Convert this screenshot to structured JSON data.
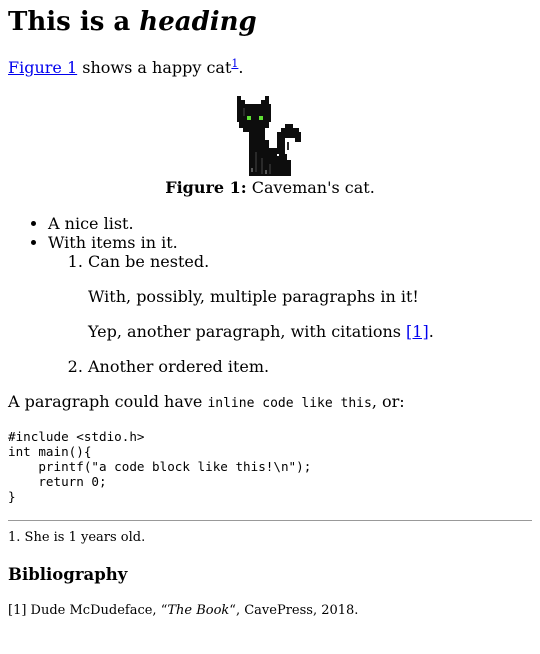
{
  "heading": {
    "prefix": "This is a ",
    "emphasis": "heading"
  },
  "intro": {
    "link_text": "Figure 1",
    "text": " shows a happy cat",
    "footnote_ref": "1",
    "period": "."
  },
  "figure": {
    "image_icon": "pixel-black-cat-icon",
    "caption_label": "Figure 1:",
    "caption_text": " Caveman's cat."
  },
  "list": {
    "items": [
      "A nice list.",
      "With items in it."
    ],
    "nested": {
      "first_item": {
        "paragraphs": [
          "Can be nested.",
          "With, possibly, multiple paragraphs in it!"
        ],
        "citation_text": "Yep, another paragraph, with citations ",
        "citation_link": "[1]",
        "citation_end": "."
      },
      "second_item": "Another ordered item."
    }
  },
  "code_paragraph": {
    "before": "A paragraph could have ",
    "inline_code": "inline code like this",
    "after": ", or:"
  },
  "code_block": "#include <stdio.h>\nint main(){\n    printf(\"a code block like this!\\n\");\n    return 0;\n}",
  "footnote": "1. She is 1 years old.",
  "bibliography": {
    "title": "Bibliography",
    "entry_prefix": "[1] Dude McDudeface, “",
    "entry_title": "The Book",
    "entry_suffix": "“, CavePress, 2018."
  }
}
